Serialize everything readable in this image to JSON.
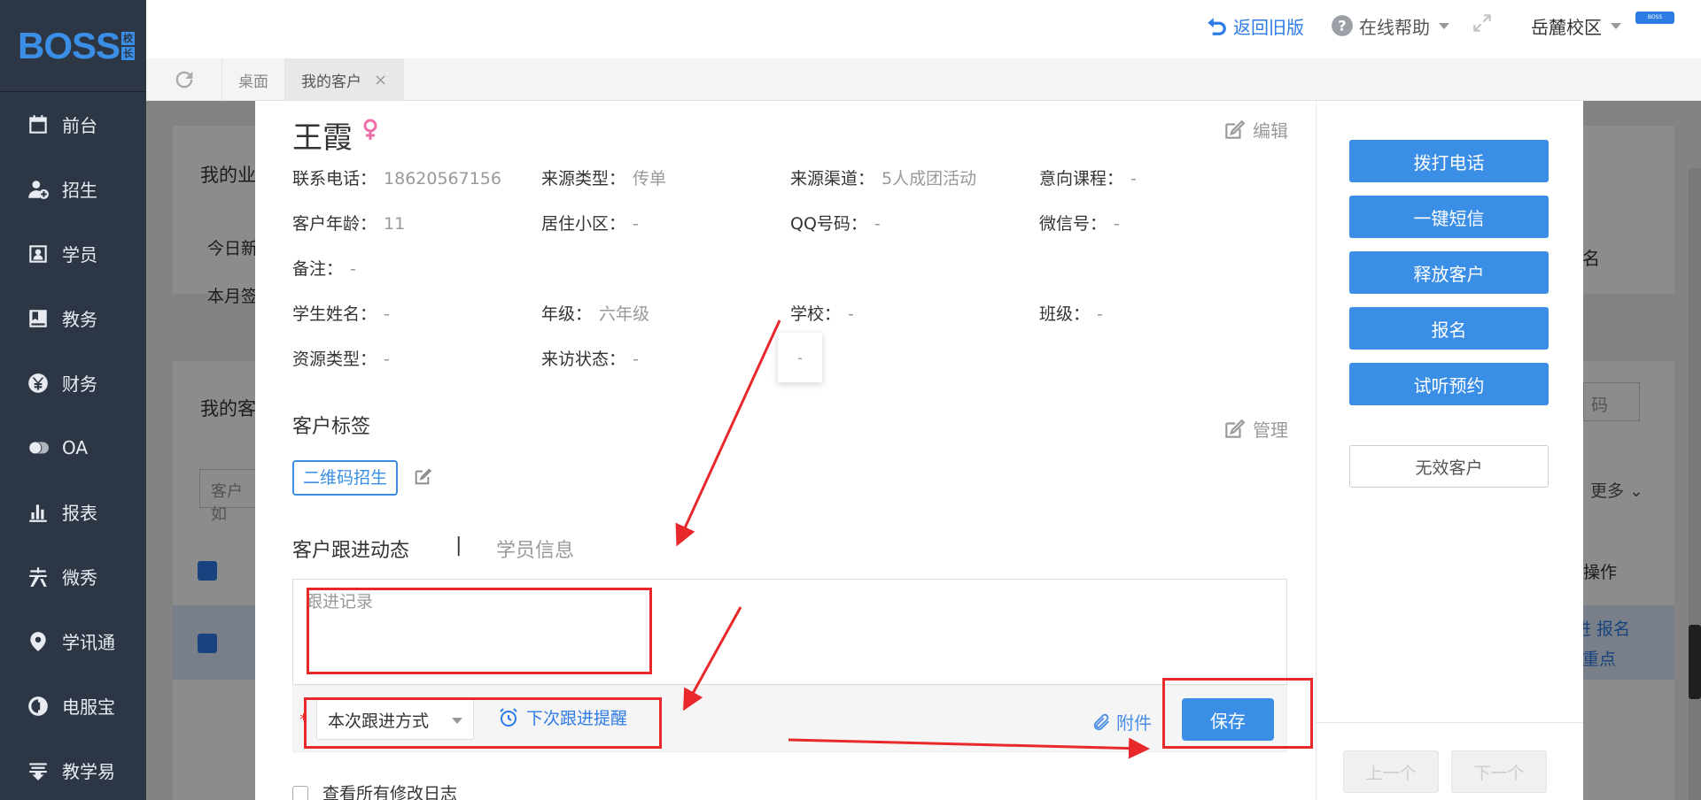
{
  "sidebar": {
    "logo": "BOSS",
    "logo_sub": [
      "校",
      "长"
    ],
    "items": [
      {
        "label": "前台",
        "icon": "calendar-icon"
      },
      {
        "label": "招生",
        "icon": "user-add-icon"
      },
      {
        "label": "学员",
        "icon": "student-card-icon"
      },
      {
        "label": "教务",
        "icon": "book-icon"
      },
      {
        "label": "财务",
        "icon": "yen-icon"
      },
      {
        "label": "OA",
        "icon": "oa-icon"
      },
      {
        "label": "报表",
        "icon": "bar-chart-icon"
      },
      {
        "label": "微秀",
        "icon": "weixiu-icon"
      },
      {
        "label": "学讯通",
        "icon": "location-chat-icon"
      },
      {
        "label": "电服宝",
        "icon": "phone-service-icon"
      },
      {
        "label": "教学易",
        "icon": "teach-icon"
      }
    ]
  },
  "header": {
    "back_old": "返回旧版",
    "help": "在线帮助",
    "campus": "岳麓校区",
    "badge": "BOSS"
  },
  "tabs": [
    {
      "label": "桌面"
    },
    {
      "label": "我的客户",
      "close": "×"
    }
  ],
  "background": {
    "card1_title": "我的业",
    "today": "今日新",
    "month": "本月签",
    "card2_title": "我的客",
    "search_placeholder": "客户如",
    "right_partial1": "名",
    "right_partial2": "码",
    "more": "更多",
    "operations": "操作",
    "row_action1": "进  报名",
    "row_action2": "重点"
  },
  "customer": {
    "name": "王霞",
    "edit_label": "编辑",
    "fields": [
      {
        "label": "联系电话：",
        "value": "18620567156"
      },
      {
        "label": "来源类型：",
        "value": "传单"
      },
      {
        "label": "来源渠道：",
        "value": "5人成团活动"
      },
      {
        "label": "意向课程：",
        "value": "-"
      },
      {
        "label": "客户年龄：",
        "value": "11"
      },
      {
        "label": "居住小区：",
        "value": "-"
      },
      {
        "label": "QQ号码：",
        "value": "-"
      },
      {
        "label": "微信号：",
        "value": "-"
      },
      {
        "label": "备注：",
        "value": "-"
      },
      {
        "label": "学生姓名：",
        "value": "-"
      },
      {
        "label": "年级：",
        "value": "六年级"
      },
      {
        "label": "学校：",
        "value": "-"
      },
      {
        "label": "班级：",
        "value": "-"
      },
      {
        "label": "资源类型：",
        "value": "-"
      },
      {
        "label": "来访状态：",
        "value": "-"
      }
    ],
    "tooltip_value": "-"
  },
  "tags_section": {
    "title": "客户标签",
    "manage": "管理",
    "tags": [
      "二维码招生"
    ]
  },
  "follow": {
    "tab_active": "客户跟进动态",
    "tab_sep": "|",
    "tab_inactive": "学员信息",
    "placeholder": "跟进记录",
    "required_mark": "*",
    "method_select": "本次跟进方式",
    "next_remind": "下次跟进提醒",
    "attach": "附件",
    "save": "保存",
    "view_log": "查看所有修改日志"
  },
  "actions": {
    "call": "拨打电话",
    "sms": "一键短信",
    "release": "释放客户",
    "enroll": "报名",
    "trial": "试听预约",
    "invalid": "无效客户",
    "prev": "上一个",
    "next": "下一个"
  },
  "colors": {
    "accent": "#3a8ee6",
    "sidebar": "#2d3644",
    "annotation": "#e8282a",
    "female": "#f06eaa"
  }
}
